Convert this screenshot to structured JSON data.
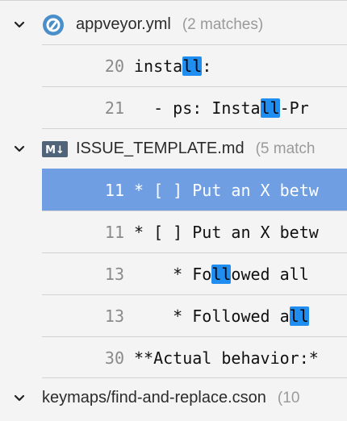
{
  "files": [
    {
      "name": "appveyor.yml",
      "count": "(2 matches)",
      "icon": "appveyor-icon",
      "matches": [
        {
          "line": "20",
          "pre": "insta",
          "hit": "ll",
          "post": ":"
        },
        {
          "line": "21",
          "pre": "  - ps: Insta",
          "hit": "ll",
          "post": "-Pr"
        }
      ]
    },
    {
      "name": "ISSUE_TEMPLATE.md",
      "count": "(5 match",
      "icon": "markdown-icon",
      "icon_label": "M↓",
      "matches": [
        {
          "line": "11",
          "pre": "* [ ] Put an X betw",
          "hit": "",
          "post": "",
          "selected": true
        },
        {
          "line": "11",
          "pre": "* [ ] Put an X betw",
          "hit": "",
          "post": ""
        },
        {
          "line": "13",
          "pre": "    * Fo",
          "hit": "ll",
          "post": "owed all"
        },
        {
          "line": "13",
          "pre": "    * Followed a",
          "hit": "ll",
          "post": " "
        },
        {
          "line": "30",
          "pre": "**Actual behavior:*",
          "hit": "",
          "post": ""
        }
      ]
    },
    {
      "name": "keymaps/find-and-replace.cson",
      "count": "(10",
      "icon": "none"
    }
  ],
  "colors": {
    "selection": "#6f9ee3",
    "highlight": "#1f8ef0"
  }
}
